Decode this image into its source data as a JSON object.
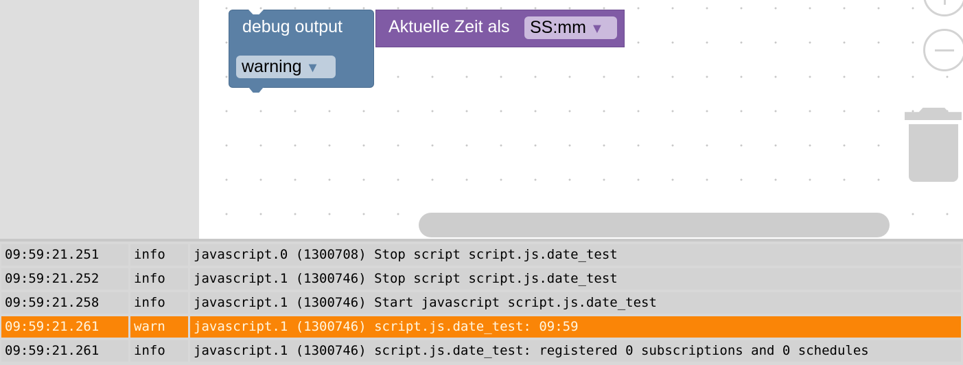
{
  "blocks": {
    "debug": {
      "label": "debug output",
      "level": "warning"
    },
    "time": {
      "label": "Aktuelle Zeit als",
      "format": "SS:mm"
    }
  },
  "controls": {
    "zoom_in": "zoom-in-icon",
    "zoom_out": "zoom-out-icon",
    "trash": "trash-icon"
  },
  "colors": {
    "debug_block": "#5b80a5",
    "time_block": "#805ba5",
    "warn_row": "#fa8507"
  },
  "log": [
    {
      "time": "09:59:21.251",
      "level": "info",
      "message": "javascript.0 (1300708) Stop script script.js.date_test"
    },
    {
      "time": "09:59:21.252",
      "level": "info",
      "message": "javascript.1 (1300746) Stop script script.js.date_test"
    },
    {
      "time": "09:59:21.258",
      "level": "info",
      "message": "javascript.1 (1300746) Start javascript script.js.date_test"
    },
    {
      "time": "09:59:21.261",
      "level": "warn",
      "message": "javascript.1 (1300746) script.js.date_test: 09:59"
    },
    {
      "time": "09:59:21.261",
      "level": "info",
      "message": "javascript.1 (1300746) script.js.date_test: registered 0 subscriptions and 0 schedules"
    }
  ]
}
